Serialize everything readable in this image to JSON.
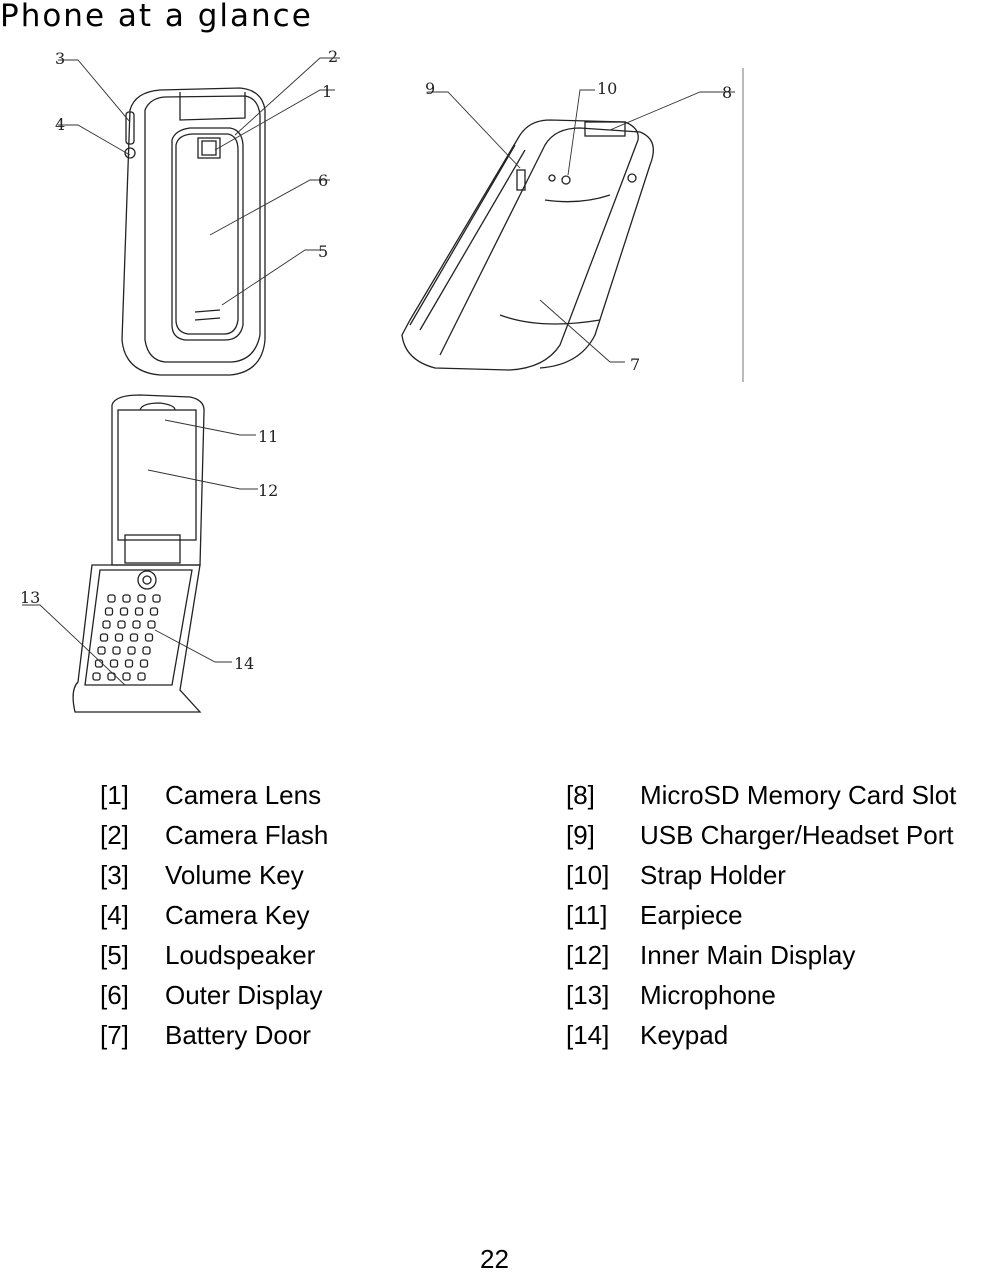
{
  "title": "Phone at a glance",
  "callouts": [
    "1",
    "2",
    "3",
    "4",
    "5",
    "6",
    "7",
    "8",
    "9",
    "10",
    "11",
    "12",
    "13",
    "14"
  ],
  "legend": {
    "left": [
      {
        "num": "[1]",
        "label": "Camera Lens"
      },
      {
        "num": "[2]",
        "label": "Camera Flash"
      },
      {
        "num": "[3]",
        "label": "Volume Key"
      },
      {
        "num": "[4]",
        "label": "Camera Key"
      },
      {
        "num": "[5]",
        "label": "Loudspeaker"
      },
      {
        "num": "[6]",
        "label": "Outer Display"
      },
      {
        "num": "[7]",
        "label": "Battery Door"
      }
    ],
    "right": [
      {
        "num": "[8]",
        "label": "MicroSD Memory Card Slot"
      },
      {
        "num": "[9]",
        "label": "USB Charger/Headset Port"
      },
      {
        "num": "[10]",
        "label": "Strap Holder"
      },
      {
        "num": "[11]",
        "label": "Earpiece"
      },
      {
        "num": "[12]",
        "label": "Inner Main Display"
      },
      {
        "num": "[13]",
        "label": "Microphone"
      },
      {
        "num": "[14]",
        "label": "Keypad"
      }
    ]
  },
  "page_number": "22"
}
